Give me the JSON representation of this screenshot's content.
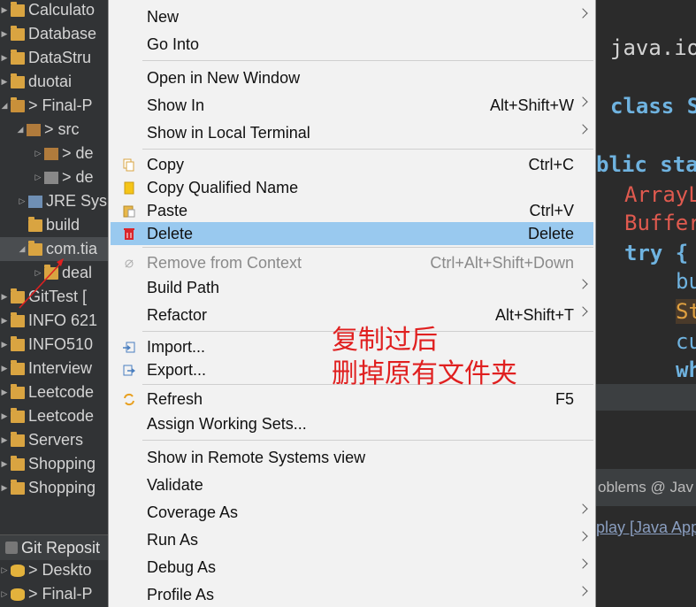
{
  "explorer": {
    "rows": [
      {
        "label": "Calculato",
        "icon": "folder-icon"
      },
      {
        "label": "Database",
        "icon": "folder-icon"
      },
      {
        "label": "DataStru",
        "icon": "folder-icon"
      },
      {
        "label": "duotai",
        "icon": "folder-icon"
      },
      {
        "label": "> Final-P",
        "icon": "project-error-icon"
      },
      {
        "label": "> src",
        "icon": "source-folder-icon"
      },
      {
        "label": "> de",
        "icon": "package-error-icon"
      },
      {
        "label": "> de",
        "icon": "package-icon"
      },
      {
        "label": "JRE Sys",
        "icon": "library-icon"
      },
      {
        "label": "build",
        "icon": "folder-icon"
      },
      {
        "label": "com.tia",
        "icon": "folder-icon"
      },
      {
        "label": "deal",
        "icon": "folder-icon"
      },
      {
        "label": "GitTest [",
        "icon": "folder-icon"
      },
      {
        "label": "INFO 621",
        "icon": "folder-icon"
      },
      {
        "label": "INFO510",
        "icon": "folder-icon"
      },
      {
        "label": "Interview",
        "icon": "folder-icon"
      },
      {
        "label": "Leetcode",
        "icon": "folder-icon"
      },
      {
        "label": "Leetcode",
        "icon": "folder-icon"
      },
      {
        "label": "Servers",
        "icon": "folder-icon"
      },
      {
        "label": "Shopping",
        "icon": "folder-icon"
      },
      {
        "label": "Shopping",
        "icon": "folder-icon"
      }
    ],
    "git_header": "Git Reposit",
    "git_rows": [
      {
        "label": "> Deskto",
        "icon": "repository-icon"
      },
      {
        "label": "> Final-P",
        "icon": "repository-icon"
      }
    ]
  },
  "editor": {
    "lines": [
      "java.io",
      "class S",
      "blic sta",
      "ArrayL",
      "Buffer",
      "try {",
      "bu",
      "St",
      "cu",
      "wh"
    ]
  },
  "bottom_tabs": {
    "label": "oblems  @ Jav"
  },
  "console": {
    "text": "play [Java App"
  },
  "context_menu": {
    "items": [
      {
        "label": "New",
        "shortcut": "",
        "submenu": true
      },
      {
        "label": "Go Into",
        "shortcut": "",
        "submenu": false
      },
      {
        "label": "Open in New Window",
        "shortcut": "",
        "submenu": false
      },
      {
        "label": "Show In",
        "shortcut": "Alt+Shift+W",
        "submenu": true
      },
      {
        "label": "Show in Local Terminal",
        "shortcut": "",
        "submenu": true
      },
      {
        "label": "Copy",
        "shortcut": "Ctrl+C",
        "submenu": false,
        "icon": "copy-icon"
      },
      {
        "label": "Copy Qualified Name",
        "shortcut": "",
        "submenu": false,
        "icon": "copy-qualified-name-icon"
      },
      {
        "label": "Paste",
        "shortcut": "Ctrl+V",
        "submenu": false,
        "icon": "paste-icon"
      },
      {
        "label": "Delete",
        "shortcut": "Delete",
        "submenu": false,
        "icon": "delete-icon"
      },
      {
        "label": "Remove from Context",
        "shortcut": "Ctrl+Alt+Shift+Down",
        "submenu": false,
        "icon": "remove-context-icon"
      },
      {
        "label": "Build Path",
        "shortcut": "",
        "submenu": true
      },
      {
        "label": "Refactor",
        "shortcut": "Alt+Shift+T",
        "submenu": true
      },
      {
        "label": "Import...",
        "shortcut": "",
        "submenu": false,
        "icon": "import-icon"
      },
      {
        "label": "Export...",
        "shortcut": "",
        "submenu": false,
        "icon": "export-icon"
      },
      {
        "label": "Refresh",
        "shortcut": "F5",
        "submenu": false,
        "icon": "refresh-icon"
      },
      {
        "label": "Assign Working Sets...",
        "shortcut": "",
        "submenu": false
      },
      {
        "label": "Show in Remote Systems view",
        "shortcut": "",
        "submenu": false
      },
      {
        "label": "Validate",
        "shortcut": "",
        "submenu": false
      },
      {
        "label": "Coverage As",
        "shortcut": "",
        "submenu": true
      },
      {
        "label": "Run As",
        "shortcut": "",
        "submenu": true
      },
      {
        "label": "Debug As",
        "shortcut": "",
        "submenu": true
      },
      {
        "label": "Profile As",
        "shortcut": "",
        "submenu": true
      }
    ],
    "selected": "Delete",
    "disabled": [
      "Remove from Context"
    ]
  },
  "annotation": {
    "line1": "复制过后",
    "line2": "删掉原有文件夹",
    "color": "#e02020"
  },
  "colors": {
    "menu_background": "#f2f2f2",
    "menu_selection": "#99c9ef",
    "editor_background": "#2b2b2b",
    "explorer_background": "#313335"
  }
}
